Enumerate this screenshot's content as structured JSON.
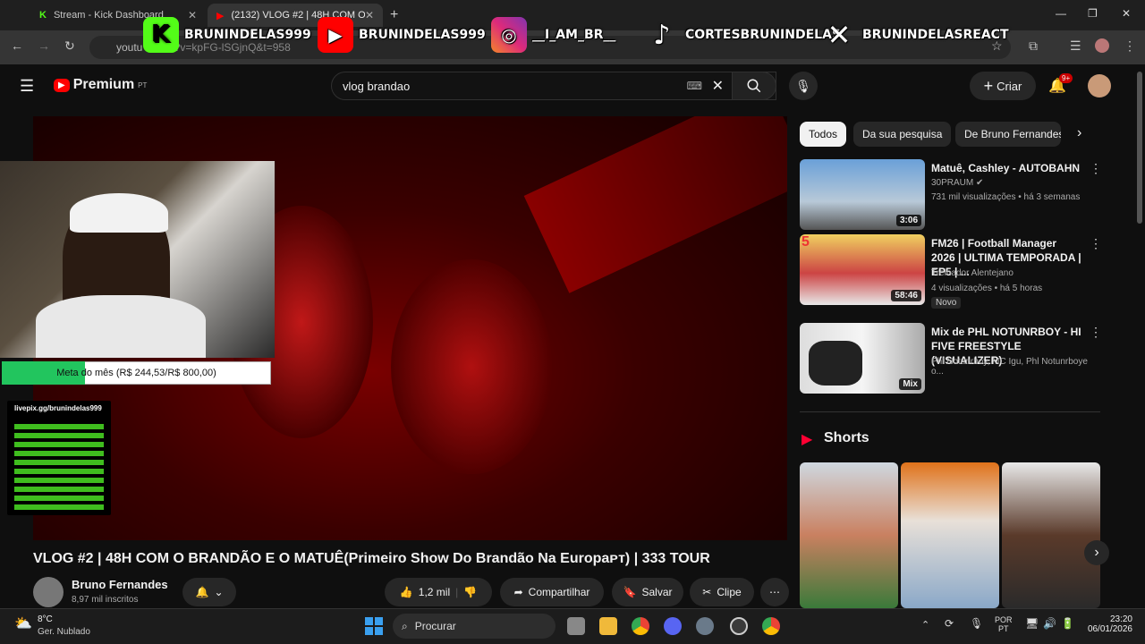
{
  "browser": {
    "tabs": [
      {
        "label": "Stream - Kick Dashboard"
      },
      {
        "label": "(2132) VLOG #2 | 48H COM O B"
      }
    ],
    "url": "youtu",
    "url_tail": "watch?v=kpFG-lSGjnQ&t=958"
  },
  "overlay": {
    "kick_handle": "BRUNINDELAS999",
    "youtube_handle": "BRUNINDELAS999",
    "instagram_handle": "__I_AM_BR__",
    "tiktok_handle": "CORTESBRUNINDELAS",
    "x_handle": "BRUNINDELASREACT",
    "goal_text": "Meta do mês (R$ 244,53/R$ 800,00)",
    "goal_progress": 0.31,
    "qr_label": "livepix.gg/brunindelas999"
  },
  "youtube": {
    "logo_text": "Premium",
    "logo_sup": "PT",
    "search_value": "vlog brandao",
    "create_label": "Criar",
    "notif_badge": "9+",
    "video_title": "VLOG #2 | 48H COM O BRANDÃO E O MATUÊ(Primeiro Show Do Brandão Na Europaᴘᴛ) | 333 TOUR",
    "channel_name": "Bruno Fernandes",
    "subscribers": "8,97 mil inscritos",
    "like_count": "1,2 mil",
    "share_label": "Compartilhar",
    "save_label": "Salvar",
    "clip_label": "Clipe",
    "chips": [
      "Todos",
      "Da sua pesquisa",
      "De Bruno Fernandes"
    ],
    "recommended": [
      {
        "title": "Matuê, Cashley - AUTOBAHN",
        "channel": "30PRAUM",
        "meta": "731 mil visualizações • há 3 semanas",
        "duration": "3:06",
        "badge": ""
      },
      {
        "title": "FM26 | Football Manager 2026 | ULTIMA TEMPORADA | EP5 | ...",
        "channel": "Treinador Alentejano",
        "meta": "4 visualizações • há 5 horas",
        "duration": "58:46",
        "badge": "Novo"
      },
      {
        "title": "Mix de PHL NOTUNRBOY - HI FIVE FREESTYLE (VISUALIZER)",
        "channel": "Phl Notunrboy, MC Igu, Phl Notunrboye o...",
        "meta": "",
        "duration": "Mix",
        "badge": ""
      }
    ],
    "shorts_title": "Shorts"
  },
  "taskbar": {
    "weather_temp": "8°C",
    "weather_desc": "Ger. Nublado",
    "search_placeholder": "Procurar",
    "lang": "POR",
    "lang2": "PT",
    "time": "23:20",
    "date": "06/01/2026"
  },
  "colors": {
    "yt_red": "#ff0000",
    "kick_green": "#53fc18",
    "goal_green": "#22c55e"
  }
}
